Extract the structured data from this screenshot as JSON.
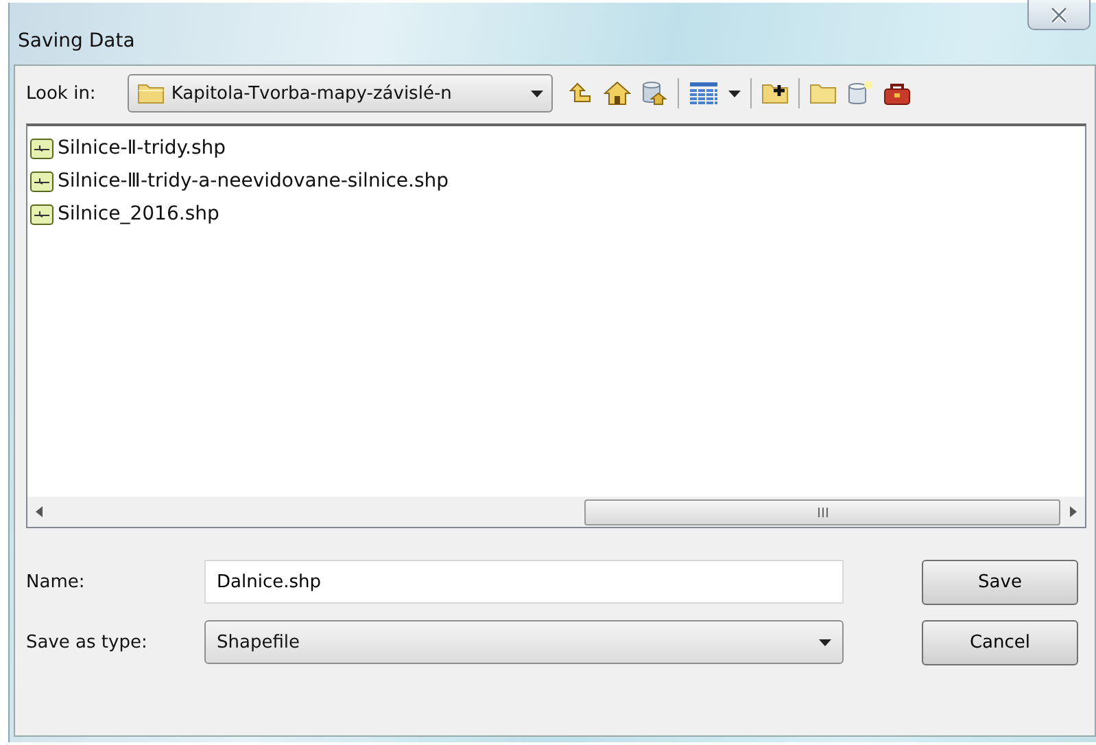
{
  "window": {
    "title": "Saving Data"
  },
  "look_in": {
    "label": "Look in:",
    "value": "Kapitola-Tvorba-mapy-závislé-n"
  },
  "files": [
    {
      "name": "Silnice-Ⅱ-tridy.shp"
    },
    {
      "name": "Silnice-Ⅲ-tridy-a-neevidovane-silnice.shp"
    },
    {
      "name": "Silnice_2016.shp"
    }
  ],
  "name_field": {
    "label": "Name:",
    "value": "Dalnice.shp"
  },
  "type_field": {
    "label": "Save as type:",
    "value": "Shapefile"
  },
  "buttons": [
    "Save",
    "Cancel"
  ]
}
